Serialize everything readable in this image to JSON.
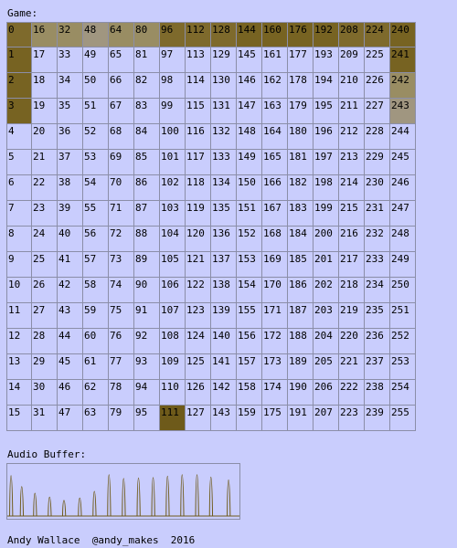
{
  "game": {
    "label": "Game:",
    "cells": [
      0,
      16,
      32,
      48,
      64,
      80,
      96,
      112,
      128,
      144,
      160,
      176,
      192,
      208,
      224,
      240,
      1,
      17,
      33,
      49,
      65,
      81,
      97,
      113,
      129,
      145,
      161,
      177,
      193,
      209,
      225,
      241,
      2,
      18,
      34,
      50,
      66,
      82,
      98,
      114,
      130,
      146,
      162,
      178,
      194,
      210,
      226,
      242,
      3,
      19,
      35,
      51,
      67,
      83,
      99,
      115,
      131,
      147,
      163,
      179,
      195,
      211,
      227,
      243,
      4,
      20,
      36,
      52,
      68,
      84,
      100,
      116,
      132,
      148,
      164,
      180,
      196,
      212,
      228,
      244,
      5,
      21,
      37,
      53,
      69,
      85,
      101,
      117,
      133,
      149,
      165,
      181,
      197,
      213,
      229,
      245,
      6,
      22,
      38,
      54,
      70,
      86,
      102,
      118,
      134,
      150,
      166,
      182,
      198,
      214,
      230,
      246,
      7,
      23,
      39,
      55,
      71,
      87,
      103,
      119,
      135,
      151,
      167,
      183,
      199,
      215,
      231,
      247,
      8,
      24,
      40,
      56,
      72,
      88,
      104,
      120,
      136,
      152,
      168,
      184,
      200,
      216,
      232,
      248,
      9,
      25,
      41,
      57,
      73,
      89,
      105,
      121,
      137,
      153,
      169,
      185,
      201,
      217,
      233,
      249,
      10,
      26,
      42,
      58,
      74,
      90,
      106,
      122,
      138,
      154,
      170,
      186,
      202,
      218,
      234,
      250,
      11,
      27,
      43,
      59,
      75,
      91,
      107,
      123,
      139,
      155,
      171,
      187,
      203,
      219,
      235,
      251,
      12,
      28,
      44,
      60,
      76,
      92,
      108,
      124,
      140,
      156,
      172,
      188,
      204,
      220,
      236,
      252,
      13,
      29,
      45,
      61,
      77,
      93,
      109,
      125,
      141,
      157,
      173,
      189,
      205,
      221,
      237,
      253,
      14,
      30,
      46,
      62,
      78,
      94,
      110,
      126,
      142,
      158,
      174,
      190,
      206,
      222,
      238,
      254,
      15,
      31,
      47,
      63,
      79,
      95,
      111,
      127,
      143,
      159,
      175,
      191,
      207,
      223,
      239,
      255
    ],
    "highlighted": {
      "0": "#7e6a2c",
      "16": "#998d63",
      "32": "#998d63",
      "48": "#a09680",
      "64": "#998d63",
      "80": "#998d63",
      "96": "#7e6a2c",
      "112": "#7e6a2c",
      "128": "#7e6a2c",
      "144": "#776322",
      "160": "#776322",
      "176": "#776322",
      "192": "#776322",
      "208": "#7e6a2c",
      "224": "#7e6a2c",
      "240": "#776322",
      "1": "#776322",
      "2": "#776322",
      "3": "#776322",
      "241": "#776322",
      "242": "#998d63",
      "243": "#a09680",
      "111": "#6e5a1a"
    }
  },
  "audio": {
    "label": "Audio Buffer:",
    "stroke_color": "#6e5a1a",
    "pulses": [
      {
        "t": 0.016,
        "level": 0.85
      },
      {
        "t": 0.062,
        "level": 0.62
      },
      {
        "t": 0.119,
        "level": 0.48
      },
      {
        "t": 0.182,
        "level": 0.4
      },
      {
        "t": 0.244,
        "level": 0.33
      },
      {
        "t": 0.312,
        "level": 0.38
      },
      {
        "t": 0.375,
        "level": 0.52
      },
      {
        "t": 0.438,
        "level": 0.87
      },
      {
        "t": 0.501,
        "level": 0.79
      },
      {
        "t": 0.565,
        "level": 0.8
      },
      {
        "t": 0.628,
        "level": 0.81
      },
      {
        "t": 0.69,
        "level": 0.84
      },
      {
        "t": 0.753,
        "level": 0.87
      },
      {
        "t": 0.817,
        "level": 0.87
      },
      {
        "t": 0.877,
        "level": 0.82
      },
      {
        "t": 0.953,
        "level": 0.76
      }
    ]
  },
  "footer": {
    "text": "Andy Wallace  @andy_makes  2016"
  }
}
